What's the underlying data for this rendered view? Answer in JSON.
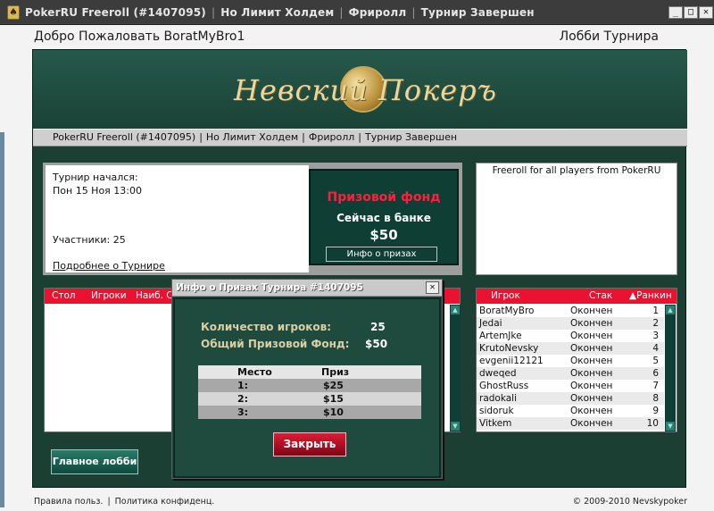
{
  "window": {
    "app_title": "PokerRU Freeroll (#1407095)",
    "title_parts": [
      "Но Лимит Холдем",
      "Фриролл",
      "Турнир Завершен"
    ],
    "min_label": "_",
    "max_label": "□",
    "close_label": "✕"
  },
  "header": {
    "welcome": "Добро Пожаловать BoratMyBro1",
    "lobby_title": "Лобби Турнира"
  },
  "banner": {
    "logo_text": "Невский Покеръ"
  },
  "info_strip": {
    "parts": [
      "PokerRU Freeroll (#1407095)",
      "Но Лимит Холдем",
      "Фриролл",
      "Турнир Завершен"
    ],
    "separator": "|"
  },
  "tournament": {
    "started_label": "Турнир начался:",
    "started_value": "Пон 15 Ноя 13:00",
    "participants": "Участники: 25",
    "details_link": "Подробнее о Турнире"
  },
  "prize_pool": {
    "title": "Призовой фонд",
    "bank_label": "Сейчас в банке",
    "amount": "$50",
    "info_button": "Инфо о призах"
  },
  "description": "Freeroll for all players from PokerRU",
  "tables": {
    "columns": [
      "Стол",
      "Игроки",
      "Наиб. С"
    ]
  },
  "players": {
    "columns": [
      "Игрок",
      "Стак",
      "▲Ранкин"
    ],
    "rows": [
      {
        "name": "BoratMyBro",
        "stack": "Окончен",
        "rank": "1"
      },
      {
        "name": "Jedai",
        "stack": "Окончен",
        "rank": "2"
      },
      {
        "name": "ArtemJke",
        "stack": "Окончен",
        "rank": "3"
      },
      {
        "name": "KrutoNevsky",
        "stack": "Окончен",
        "rank": "4"
      },
      {
        "name": "evgenii12121",
        "stack": "Окончен",
        "rank": "5"
      },
      {
        "name": "dweqed",
        "stack": "Окончен",
        "rank": "6"
      },
      {
        "name": "GhostRuss",
        "stack": "Окончен",
        "rank": "7"
      },
      {
        "name": "radokali",
        "stack": "Окончен",
        "rank": "8"
      },
      {
        "name": "sidoruk",
        "stack": "Окончен",
        "rank": "9"
      },
      {
        "name": "Vitkem",
        "stack": "Окончен",
        "rank": "10"
      }
    ]
  },
  "main_lobby_button": "Главное лобби",
  "footer": {
    "terms": "Правила польз.",
    "privacy": "Политика конфиденц.",
    "separator": "|",
    "copyright": "© 2009-2010 Nevskypoker"
  },
  "dialog": {
    "title": "Инфо о Призах Турнира #1407095",
    "close_x": "✕",
    "players_label": "Количество игроков:",
    "players_value": "25",
    "pool_label": "Общий Призовой Фонд:",
    "pool_value": "$50",
    "table_headers": [
      "Место",
      "Приз"
    ],
    "prizes": [
      {
        "place": "1:",
        "prize": "$25"
      },
      {
        "place": "2:",
        "prize": "$15"
      },
      {
        "place": "3:",
        "prize": "$10"
      }
    ],
    "close_button": "Закрыть"
  },
  "colors": {
    "panel_green": "#1c3f34",
    "header_red": "#ea1131",
    "prize_red": "#ff1f3b",
    "dialog_green": "#1f4a3e"
  }
}
